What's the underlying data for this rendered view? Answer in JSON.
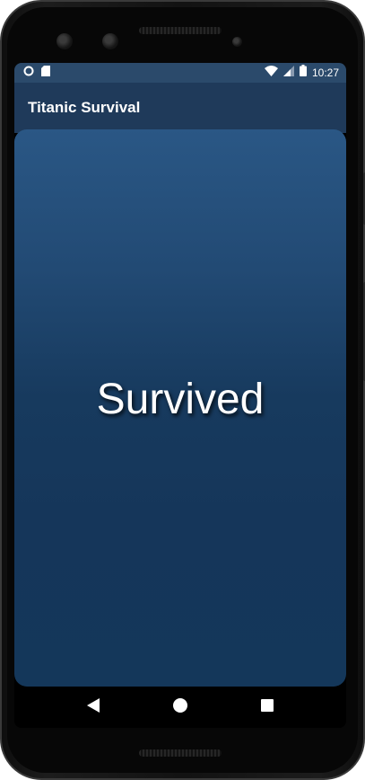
{
  "status_bar": {
    "time": "10:27",
    "icons": [
      "circle-notification-icon",
      "sd-card-icon",
      "wifi-icon",
      "signal-icon",
      "battery-icon"
    ]
  },
  "app_bar": {
    "title": "Titanic Survival"
  },
  "main": {
    "result_text": "Survived"
  },
  "nav_bar": {
    "buttons": [
      "back-icon",
      "home-icon",
      "recents-icon"
    ]
  },
  "colors": {
    "status_bar": "#2b4a6b",
    "app_bar": "#1f3a5a",
    "content_top": "#2a5785",
    "content_bottom": "#14375a"
  }
}
